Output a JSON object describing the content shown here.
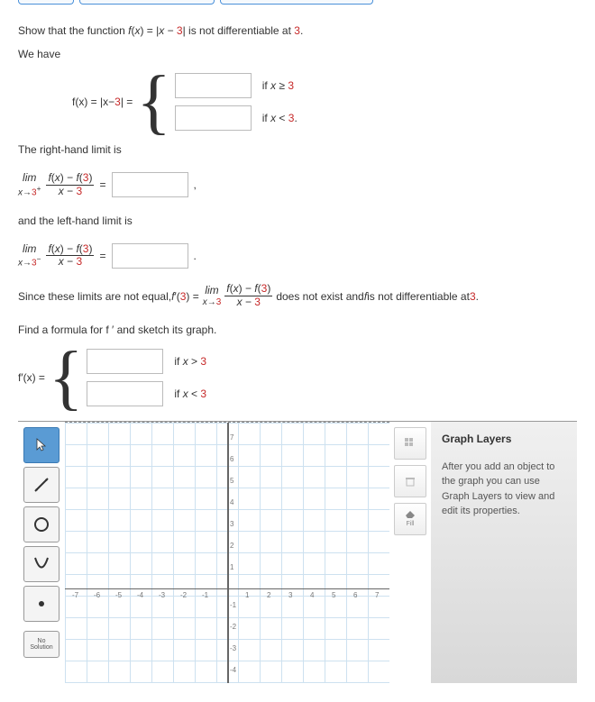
{
  "problem": {
    "intro_prefix": "Show that the function ",
    "fx": "f",
    "x": "x",
    "eq": " = |",
    "minus_part": " − ",
    "three": "3",
    "intro_suffix": "| is not differentiable at ",
    "period": ".",
    "we_have": "We have",
    "fxeq": "f(x) = |x − 3| =",
    "if1": "if x ≥ ",
    "if2": "if x < ",
    "rightlimit": "The right-hand limit is",
    "leftlimit": "and the left-hand limit is",
    "lim": "lim",
    "limsub_r": "x→3",
    "plus": "+",
    "minus": "−",
    "fracnum": "f(x) − f(",
    "fracnum2": ")",
    "fracden": "x − ",
    "comma": ",",
    "dot": ".",
    "since_prefix": "Since these limits are not equal, ",
    "fprime": "f ′(",
    "since_mid": ") = ",
    "limsub": "x→3",
    "since_suffix1": " does not exist and ",
    "f": "f",
    "since_suffix2": " is not differentiable at ",
    "find": "Find a formula for f ′ and sketch its graph.",
    "fprimex": "f ′(x) =",
    "ifgt": "if x > ",
    "iflt": "if x < "
  },
  "graph": {
    "yticks": [
      "7",
      "6",
      "5",
      "4",
      "3",
      "2",
      "1",
      "-1",
      "-2",
      "-3",
      "-4"
    ],
    "xticks": [
      "-7",
      "-6",
      "-5",
      "-4",
      "-3",
      "-2",
      "-1",
      "1",
      "2",
      "3",
      "4",
      "5",
      "6",
      "7"
    ]
  },
  "tools": {
    "noSolution1": "No",
    "noSolution2": "Solution",
    "fill": "Fill"
  },
  "layers": {
    "title": "Graph Layers",
    "text": "After you add an object to the graph you can use Graph Layers to view and edit its properties."
  }
}
